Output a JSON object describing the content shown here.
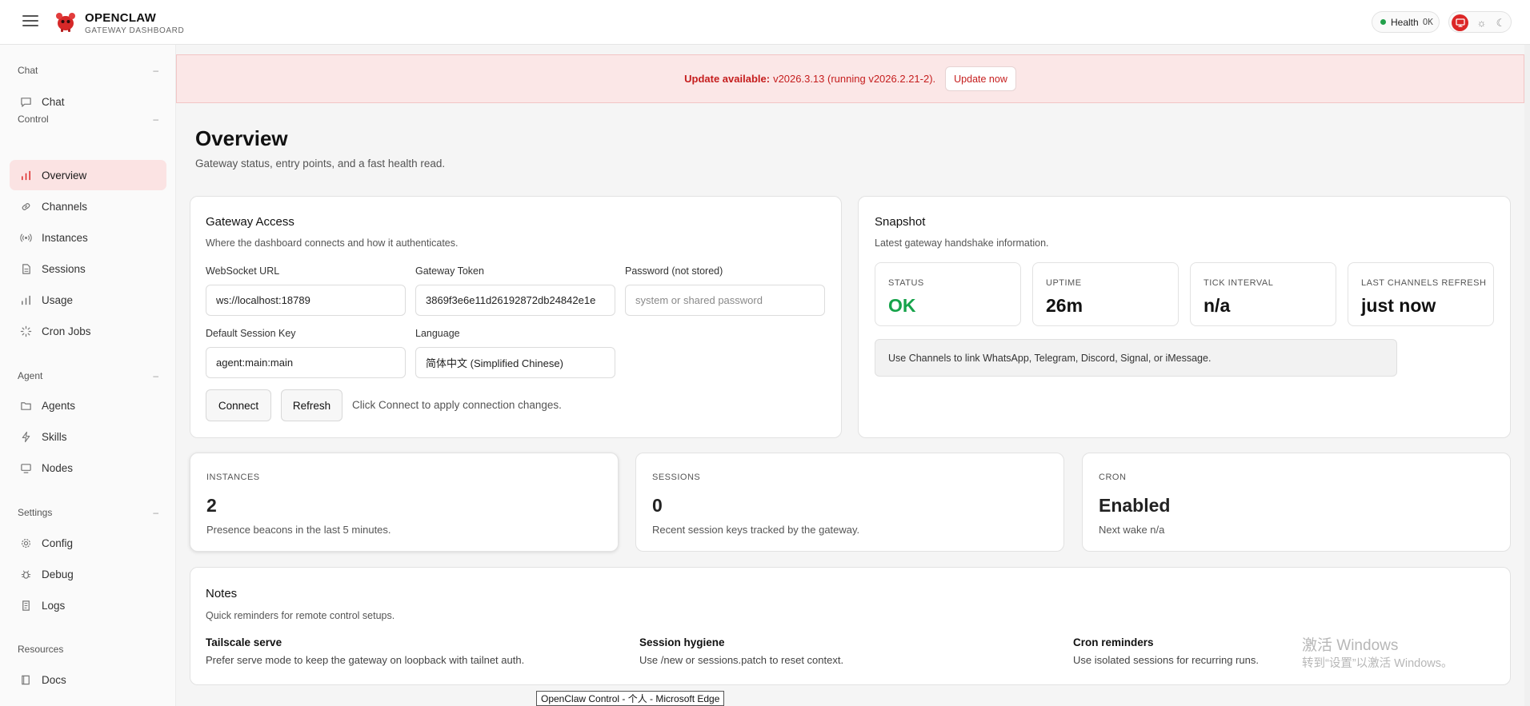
{
  "header": {
    "brand_title": "OPENCLAW",
    "brand_subtitle": "GATEWAY DASHBOARD",
    "health_label": "Health",
    "health_value": "OK",
    "accent_color": "#dc2626"
  },
  "sidebar": {
    "sections": [
      {
        "title": "Chat",
        "items": [
          {
            "label": "Chat",
            "icon": "message-icon"
          }
        ]
      },
      {
        "title": "Control",
        "items": [
          {
            "label": "Overview",
            "icon": "bar-chart-icon",
            "active": true
          },
          {
            "label": "Channels",
            "icon": "link-icon"
          },
          {
            "label": "Instances",
            "icon": "radio-icon"
          },
          {
            "label": "Sessions",
            "icon": "file-icon"
          },
          {
            "label": "Usage",
            "icon": "bar-chart-icon"
          },
          {
            "label": "Cron Jobs",
            "icon": "loader-icon"
          }
        ]
      },
      {
        "title": "Agent",
        "items": [
          {
            "label": "Agents",
            "icon": "folder-icon"
          },
          {
            "label": "Skills",
            "icon": "zap-icon"
          },
          {
            "label": "Nodes",
            "icon": "monitor-icon"
          }
        ]
      },
      {
        "title": "Settings",
        "items": [
          {
            "label": "Config",
            "icon": "gear-icon"
          },
          {
            "label": "Debug",
            "icon": "bug-icon"
          },
          {
            "label": "Logs",
            "icon": "scroll-icon"
          }
        ]
      },
      {
        "title": "Resources",
        "items": [
          {
            "label": "Docs",
            "icon": "book-icon"
          }
        ]
      }
    ]
  },
  "banner": {
    "strong": "Update available:",
    "text": "v2026.3.13 (running v2026.2.21-2).",
    "button": "Update now"
  },
  "page": {
    "title": "Overview",
    "subtitle": "Gateway status, entry points, and a fast health read."
  },
  "gateway_access": {
    "title": "Gateway Access",
    "subtitle": "Where the dashboard connects and how it authenticates.",
    "websocket_label": "WebSocket URL",
    "websocket_value": "ws://localhost:18789",
    "token_label": "Gateway Token",
    "token_value": "3869f3e6e11d26192872db24842e1e",
    "password_label": "Password (not stored)",
    "password_placeholder": "system or shared password",
    "session_key_label": "Default Session Key",
    "session_key_value": "agent:main:main",
    "language_label": "Language",
    "language_value": "简体中文 (Simplified Chinese)",
    "connect_button": "Connect",
    "refresh_button": "Refresh",
    "hint": "Click Connect to apply connection changes."
  },
  "snapshot": {
    "title": "Snapshot",
    "subtitle": "Latest gateway handshake information.",
    "stats": [
      {
        "label": "STATUS",
        "value": "OK"
      },
      {
        "label": "UPTIME",
        "value": "26m"
      },
      {
        "label": "TICK INTERVAL",
        "value": "n/a"
      },
      {
        "label": "LAST CHANNELS REFRESH",
        "value": "just now"
      }
    ],
    "tip": "Use Channels to link WhatsApp, Telegram, Discord, Signal, or iMessage.",
    "ok_color": "#16a34a"
  },
  "metrics": [
    {
      "label": "INSTANCES",
      "value": "2",
      "sub": "Presence beacons in the last 5 minutes."
    },
    {
      "label": "SESSIONS",
      "value": "0",
      "sub": "Recent session keys tracked by the gateway."
    },
    {
      "label": "CRON",
      "value": "Enabled",
      "sub": "Next wake n/a"
    }
  ],
  "notes": {
    "title": "Notes",
    "subtitle": "Quick reminders for remote control setups.",
    "items": [
      {
        "title": "Tailscale serve",
        "text": "Prefer serve mode to keep the gateway on loopback with tailnet auth."
      },
      {
        "title": "Session hygiene",
        "text": "Use /new or sessions.patch to reset context."
      },
      {
        "title": "Cron reminders",
        "text": "Use isolated sessions for recurring runs."
      }
    ]
  },
  "os": {
    "watermark_line1": "激活 Windows",
    "watermark_line2": "转到“设置”以激活 Windows。",
    "taskbar_tooltip": "OpenClaw Control - 个人 - Microsoft Edge"
  }
}
